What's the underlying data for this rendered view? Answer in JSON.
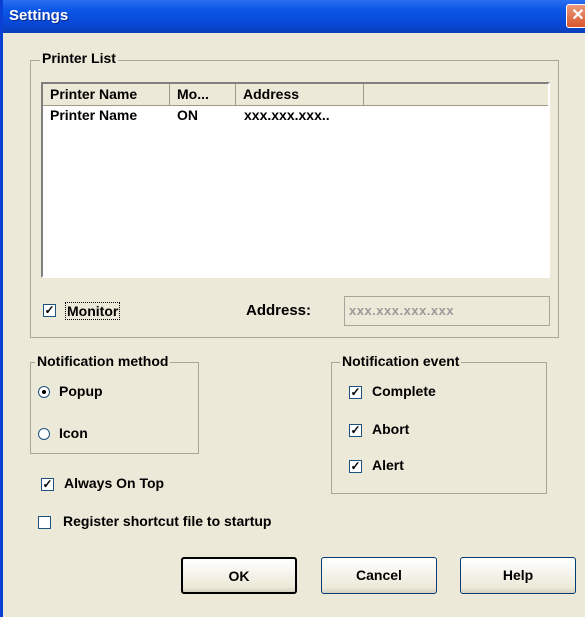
{
  "window": {
    "title": "Settings",
    "close_glyph": "✕"
  },
  "printer_list": {
    "group_label": "Printer List",
    "columns": [
      "Printer Name",
      "Mo...",
      "Address"
    ],
    "rows": [
      {
        "name": "Printer Name",
        "monitor": "ON",
        "address": "xxx.xxx.xxx.."
      }
    ],
    "monitor_label": "Monitor",
    "monitor_checked": true,
    "address_label": "Address:",
    "address_placeholder": "xxx.xxx.xxx.xxx"
  },
  "notification_method": {
    "group_label": "Notification method",
    "options": [
      {
        "label": "Popup",
        "selected": true
      },
      {
        "label": "Icon",
        "selected": false
      }
    ]
  },
  "notification_event": {
    "group_label": "Notification event",
    "items": [
      {
        "label": "Complete",
        "checked": true
      },
      {
        "label": "Abort",
        "checked": true
      },
      {
        "label": "Alert",
        "checked": true
      }
    ]
  },
  "options": {
    "always_on_top_label": "Always On Top",
    "always_on_top_checked": true,
    "register_startup_label": "Register shortcut file to startup",
    "register_startup_checked": false
  },
  "buttons": {
    "ok": "OK",
    "cancel": "Cancel",
    "help": "Help"
  },
  "colors": {
    "titlebar": "#0848d6",
    "dialog_bg": "#ece9d8",
    "close_button": "#d9552e"
  }
}
